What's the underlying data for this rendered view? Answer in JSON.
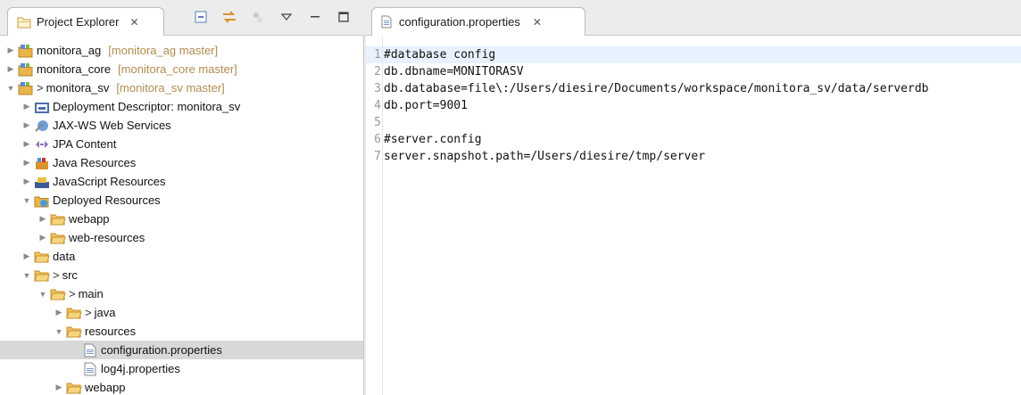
{
  "explorer": {
    "tab_label": "Project Explorer",
    "close_glyph": "✕",
    "tools": [
      "collapse-all-icon",
      "link-with-editor-icon",
      "filters-icon",
      "view-menu-icon",
      "minimize-icon",
      "maximize-icon"
    ],
    "tree": [
      {
        "indent": 0,
        "twisty": "closed",
        "icon": "project-icon",
        "prefix": "",
        "label": "monitora_ag",
        "repo": "[monitora_ag master]"
      },
      {
        "indent": 0,
        "twisty": "closed",
        "icon": "project-icon",
        "prefix": "",
        "label": "monitora_core",
        "repo": "[monitora_core master]"
      },
      {
        "indent": 0,
        "twisty": "open",
        "icon": "project-icon",
        "prefix": ">",
        "label": "monitora_sv",
        "repo": "[monitora_sv master]"
      },
      {
        "indent": 1,
        "twisty": "closed",
        "icon": "deployment-descriptor-icon",
        "prefix": "",
        "label": "Deployment Descriptor: monitora_sv",
        "repo": ""
      },
      {
        "indent": 1,
        "twisty": "closed",
        "icon": "web-services-icon",
        "prefix": "",
        "label": "JAX-WS Web Services",
        "repo": ""
      },
      {
        "indent": 1,
        "twisty": "closed",
        "icon": "jpa-icon",
        "prefix": "",
        "label": "JPA Content",
        "repo": ""
      },
      {
        "indent": 1,
        "twisty": "closed",
        "icon": "java-resources-icon",
        "prefix": "",
        "label": "Java Resources",
        "repo": ""
      },
      {
        "indent": 1,
        "twisty": "closed",
        "icon": "javascript-resources-icon",
        "prefix": "",
        "label": "JavaScript Resources",
        "repo": ""
      },
      {
        "indent": 1,
        "twisty": "open",
        "icon": "deployed-resources-icon",
        "prefix": "",
        "label": "Deployed Resources",
        "repo": ""
      },
      {
        "indent": 2,
        "twisty": "closed",
        "icon": "folder-icon",
        "prefix": "",
        "label": "webapp",
        "repo": ""
      },
      {
        "indent": 2,
        "twisty": "closed",
        "icon": "folder-icon",
        "prefix": "",
        "label": "web-resources",
        "repo": ""
      },
      {
        "indent": 1,
        "twisty": "closed",
        "icon": "folder-icon",
        "prefix": "",
        "label": "data",
        "repo": ""
      },
      {
        "indent": 1,
        "twisty": "open",
        "icon": "folder-icon",
        "prefix": ">",
        "label": "src",
        "repo": ""
      },
      {
        "indent": 2,
        "twisty": "open",
        "icon": "folder-icon",
        "prefix": ">",
        "label": "main",
        "repo": ""
      },
      {
        "indent": 3,
        "twisty": "closed",
        "icon": "folder-icon",
        "prefix": ">",
        "label": "java",
        "repo": ""
      },
      {
        "indent": 3,
        "twisty": "open",
        "icon": "folder-icon",
        "prefix": "",
        "label": "resources",
        "repo": ""
      },
      {
        "indent": 4,
        "twisty": "none",
        "icon": "properties-file-icon",
        "prefix": "",
        "label": "configuration.properties",
        "repo": "",
        "selected": true
      },
      {
        "indent": 4,
        "twisty": "none",
        "icon": "properties-file-icon",
        "prefix": "",
        "label": "log4j.properties",
        "repo": ""
      },
      {
        "indent": 3,
        "twisty": "closed",
        "icon": "folder-icon",
        "prefix": "",
        "label": "webapp",
        "repo": ""
      }
    ]
  },
  "editor": {
    "tab_label": "configuration.properties",
    "close_glyph": "✕",
    "lines": [
      {
        "n": "1",
        "text": "#database config",
        "current": true
      },
      {
        "n": "2",
        "text": "db.dbname=MONITORASV"
      },
      {
        "n": "3",
        "text": "db.database=file\\:/Users/diesire/Documents/workspace/monitora_sv/data/serverdb"
      },
      {
        "n": "4",
        "text": "db.port=9001"
      },
      {
        "n": "5",
        "text": ""
      },
      {
        "n": "6",
        "text": "#server.config"
      },
      {
        "n": "7",
        "text": "server.snapshot.path=/Users/diesire/tmp/server"
      }
    ]
  }
}
